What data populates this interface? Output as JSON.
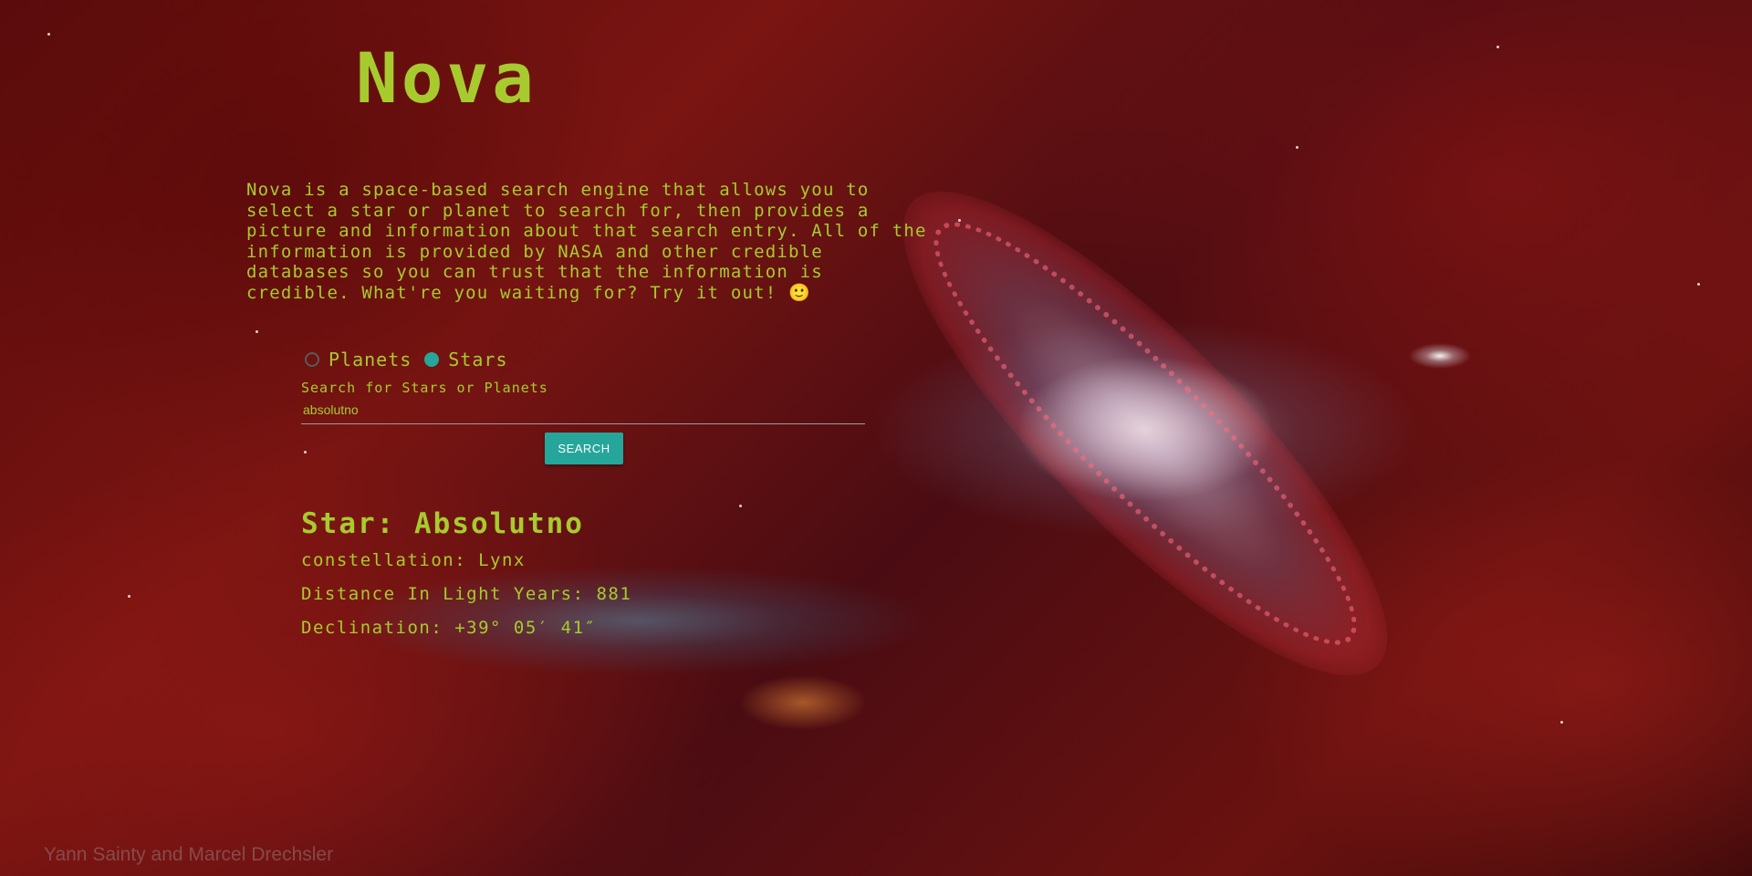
{
  "header": {
    "title": "Nova"
  },
  "intro": {
    "text": "Nova is a space-based search engine that allows you to\nselect a star or planet to search for, then provides a\npicture and information about that search entry. All of the\ninformation is provided by NASA and other credible\ndatabases so you can trust that the information is\ncredible. What're you waiting for? Try it out! 🙂"
  },
  "search": {
    "radio_planets_label": "Planets",
    "radio_stars_label": "Stars",
    "selected": "Stars",
    "label": "Search for Stars or Planets",
    "value": "absolutno",
    "button_label": "SEARCH"
  },
  "result": {
    "title": "Star: Absolutno",
    "constellation": "constellation: Lynx",
    "distance": "Distance In Light Years: 881",
    "declination": "Declination: +39° 05′ 41″"
  },
  "background": {
    "credit": "Yann Sainty and Marcel Drechsler"
  },
  "colors": {
    "accent": "#a7cb2e",
    "button": "#26a69a"
  }
}
